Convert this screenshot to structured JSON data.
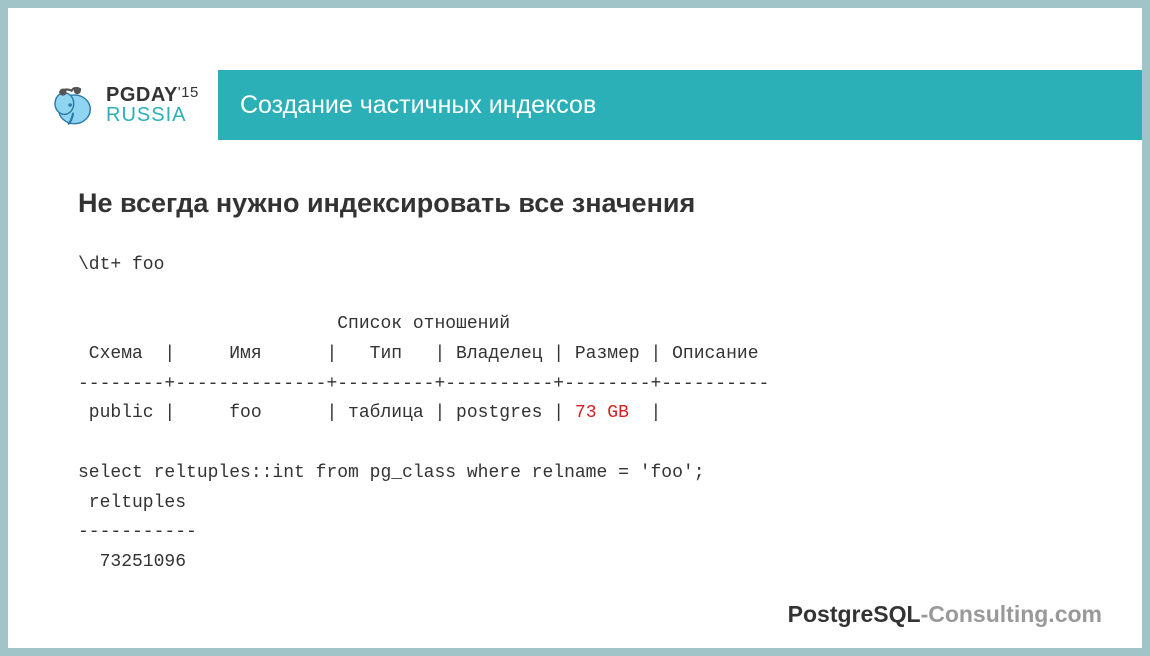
{
  "logo": {
    "line1_main": "PGDAY",
    "line1_year": "'15",
    "line2": "RUSSIA"
  },
  "title": "Создание частичных индексов",
  "heading": "Не всегда нужно индексировать все значения",
  "code": {
    "l1": "\\dt+ foo",
    "l2": "                        Список отношений",
    "l3": " Схема  |     Имя      |   Тип   | Владелец | Размер | Описание",
    "l4": "--------+--------------+---------+----------+--------+----------",
    "l5a": " public |     foo      | таблица | postgres | ",
    "l5b": "73 GB",
    "l5c": "  |",
    "l6": "select reltuples::int from pg_class where relname = 'foo';",
    "l7": " reltuples",
    "l8": "-----------",
    "l9": "  73251096"
  },
  "footer": {
    "part1": "PostgreSQL",
    "part2": "-Consulting.com"
  }
}
